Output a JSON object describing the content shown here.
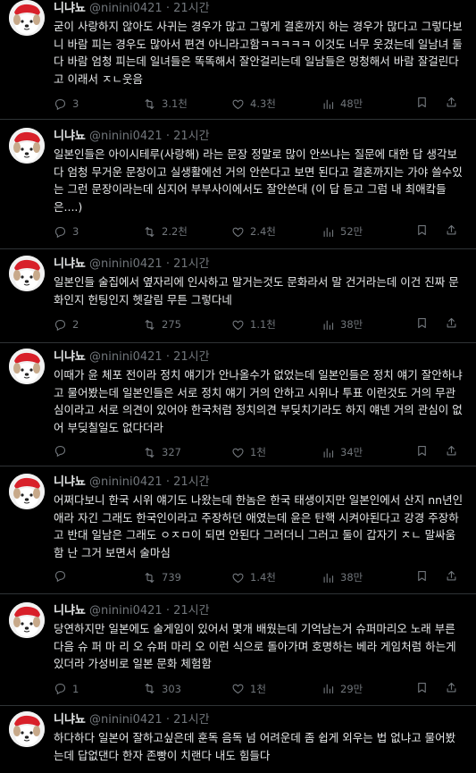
{
  "colors": {
    "background": "#000000",
    "text": "#e7e9ea",
    "muted": "#71767b",
    "divider": "#2f3336"
  },
  "posts": [
    {
      "name": "니냐뇨",
      "handle": "@ninini0421",
      "time": "21시간",
      "text": "굳이 사랑하지 않아도 사귀는 경우가 많고 그렇게 결혼까지 하는 경우가 많다고 그렇다보니 바람 피는 경우도 많아서 편견 아니라고함ㅋㅋㅋㅋㅋ 이것도 너무 웃겼는데 일남녀 둘다 바람 엄청 피는데 일녀들은 똑똑해서 잘안걸리는데 일남들은 멍청해서 바람 잘걸린다고 이래서 ㅈㄴ웃음",
      "replies": "3",
      "reposts": "3.1천",
      "likes": "4.3천",
      "views": "48만"
    },
    {
      "name": "니냐뇨",
      "handle": "@ninini0421",
      "time": "21시간",
      "text": "일본인들은 아이시테루(사랑해) 라는 문장 정말로 많이 안쓰냐는 질문에 대한 답 생각보다 엄청 무거운 문장이고 실생활에선 거의 안쓴다고 보면 된다고 결혼까지는 가야 쓸수있는 그런 문장이라는데 심지어 부부사이에서도 잘안쓴대 (이 답 듣고 그럼 내 최애캌들은....)",
      "replies": "3",
      "reposts": "2.2천",
      "likes": "2.4천",
      "views": "52만"
    },
    {
      "name": "니냐뇨",
      "handle": "@ninini0421",
      "time": "21시간",
      "text": "일본인들 술집에서 옆자리에 인사하고 말거는것도 문화라서 말 건거라는데 이건 진짜 문화인지 헌팅인지 헷갈림 무튼 그렇다네",
      "replies": "2",
      "reposts": "275",
      "likes": "1.1천",
      "views": "38만"
    },
    {
      "name": "니냐뇨",
      "handle": "@ninini0421",
      "time": "21시간",
      "text": "이때가 윤 체포 전이라 정치 얘기가 안나올수가 없었는데 일본인들은 정치 얘기 잘안하냐고 물어봤는데 일본인들은 서로 정치 얘기 거의 안하고 시위나 투표 이런것도 거의 무관심이라고 서로 의견이 있어야 한국처럼 정치의견 부딪치기라도 하지 얘넨 거의 관심이 없어 부딪칠일도 없다더라",
      "replies": "",
      "reposts": "327",
      "likes": "1천",
      "views": "34만"
    },
    {
      "name": "니냐뇨",
      "handle": "@ninini0421",
      "time": "21시간",
      "text": "어쩌다보니 한국 시위 얘기도 나왔는데 한놈은 한국 태생이지만 일본인에서 산지 nn년인 애라 자긴 그래도 한국인이라고 주장하던 애였는데 윤은 탄핵 시켜야된다고 강경 주장하고 반대 일남은 그래도 ㅇㅈㅁ이 되면 안된다 그러더니 그러고 둘이 갑자기 ㅈㄴ 말싸움함 난 그거 보면서 술마심",
      "replies": "",
      "reposts": "739",
      "likes": "1.4천",
      "views": "38만"
    },
    {
      "name": "니냐뇨",
      "handle": "@ninini0421",
      "time": "21시간",
      "text": "당연하지만 일본에도 술게임이 있어서 몇개 배웠는데 기억남는거 슈퍼마리오 노래 부른다음 슈 퍼 마 리 오 슈퍼 마리 오 이런 식으로 돌아가며 호명하는 베라 게임처럼 하는게 있더라 가성비로 일본 문화 체험함",
      "replies": "1",
      "reposts": "303",
      "likes": "1천",
      "views": "29만"
    },
    {
      "name": "니냐뇨",
      "handle": "@ninini0421",
      "time": "21시간",
      "text": "하다하다 일본어 잘하고싶은데 훈독 음독 넘 어려운데 좀 쉽게 외우는 법 없냐고 물어봤는데 답없댄다 한자 존빵이 치랜다 내도 힘들다",
      "replies": "",
      "reposts": "",
      "likes": "",
      "views": ""
    }
  ]
}
